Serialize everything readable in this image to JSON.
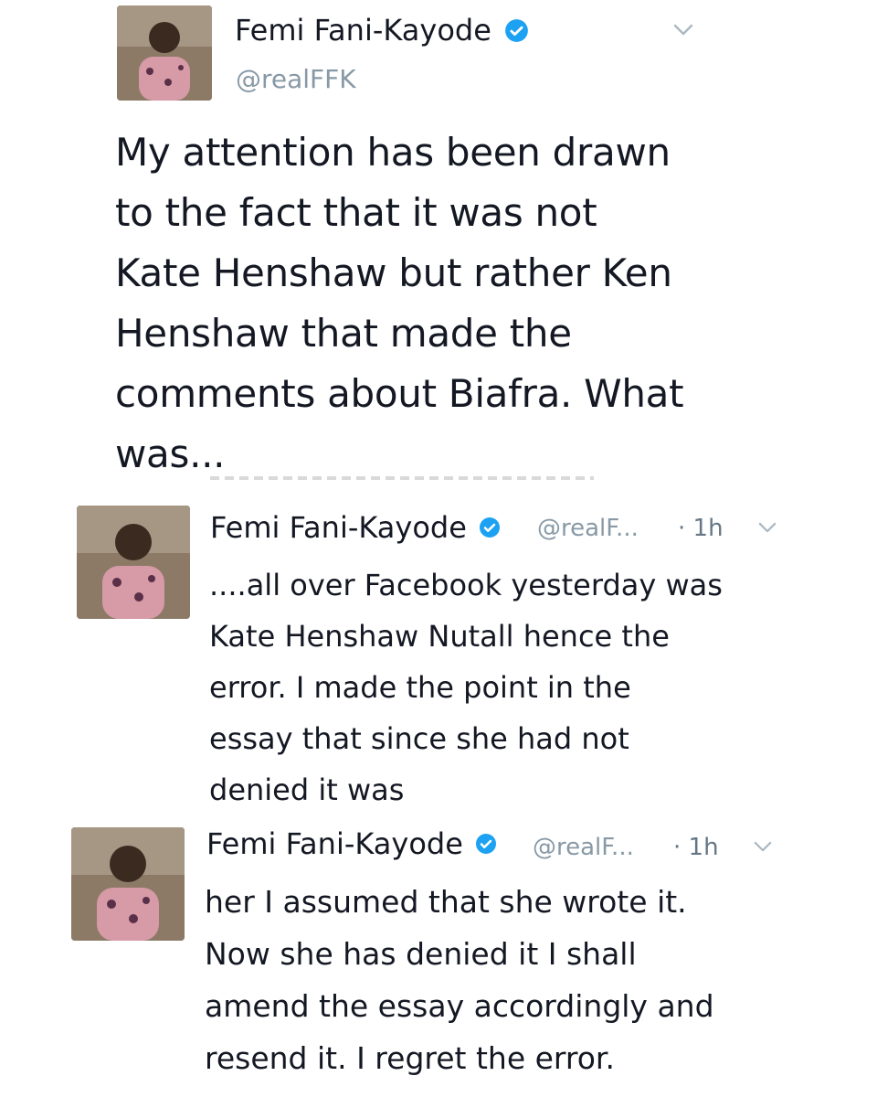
{
  "tweets": [
    {
      "author": "Femi Fani-Kayode",
      "handle": "@realFFK",
      "verified": true,
      "lines": [
        "My attention has been drawn",
        "to the fact that it was not",
        "Kate Henshaw but rather Ken",
        "Henshaw that made the",
        "comments about Biafra. What",
        "was..."
      ]
    },
    {
      "author": "Femi Fani-Kayode",
      "handle": "@realF...",
      "time": "· 1h",
      "verified": true,
      "lines": [
        "....all over Facebook yesterday was",
        "Kate Henshaw Nutall hence the",
        "error. I made the point in the",
        "essay that since she had not",
        "denied it was"
      ]
    },
    {
      "author": "Femi Fani-Kayode",
      "handle": "@realF...",
      "time": "· 1h",
      "verified": true,
      "lines": [
        "her I assumed that she wrote it.",
        "Now she has denied it I shall",
        "amend the essay accordingly and",
        "resend it. I regret the error."
      ]
    }
  ],
  "colors": {
    "verified": "#1da1f2",
    "muted": "#8899a6",
    "text": "#141823"
  },
  "icons": [
    "avatar",
    "verified-badge-icon",
    "chevron-down-icon"
  ]
}
